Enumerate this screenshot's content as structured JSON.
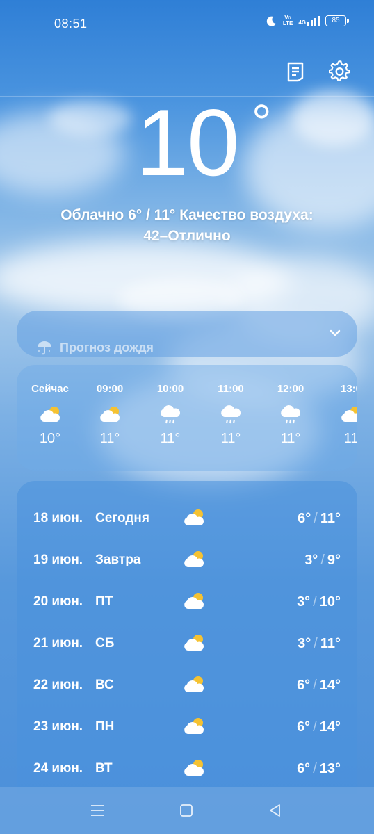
{
  "status_bar": {
    "time": "08:51",
    "volte_top": "Vo",
    "volte_bottom": "LTE",
    "network": "4G",
    "battery": "85"
  },
  "top_actions": {
    "report_icon": "report-icon",
    "settings_icon": "gear-icon"
  },
  "current": {
    "temperature": "10",
    "degree": "°",
    "summary_line1": "Облачно  6° / 11°  Качество воздуха:",
    "summary_line2": "42–Отлично"
  },
  "rain_forecast": {
    "label": "Прогноз дождя",
    "icon": "umbrella-icon"
  },
  "hourly": [
    {
      "time": "Сейчас",
      "icon": "partly-cloudy",
      "temp": "10°"
    },
    {
      "time": "09:00",
      "icon": "partly-cloudy",
      "temp": "11°"
    },
    {
      "time": "10:00",
      "icon": "rain",
      "temp": "11°"
    },
    {
      "time": "11:00",
      "icon": "rain",
      "temp": "11°"
    },
    {
      "time": "12:00",
      "icon": "rain",
      "temp": "11°"
    },
    {
      "time": "13:0",
      "icon": "partly-cloudy",
      "temp": "11"
    }
  ],
  "daily": [
    {
      "date": "18 июн.",
      "day": "Сегодня",
      "low": "6°",
      "high": "11°"
    },
    {
      "date": "19 июн.",
      "day": "Завтра",
      "low": "3°",
      "high": "9°"
    },
    {
      "date": "20 июн.",
      "day": "ПТ",
      "low": "3°",
      "high": "10°"
    },
    {
      "date": "21 июн.",
      "day": "СБ",
      "low": "3°",
      "high": "11°"
    },
    {
      "date": "22 июн.",
      "day": "ВС",
      "low": "6°",
      "high": "14°"
    },
    {
      "date": "23 июн.",
      "day": "ПН",
      "low": "6°",
      "high": "14°"
    },
    {
      "date": "24 июн.",
      "day": "ВТ",
      "low": "6°",
      "high": "13°"
    }
  ],
  "range_separator": "/",
  "colors": {
    "sun": "#f5c232",
    "cloud": "#ffffff"
  }
}
